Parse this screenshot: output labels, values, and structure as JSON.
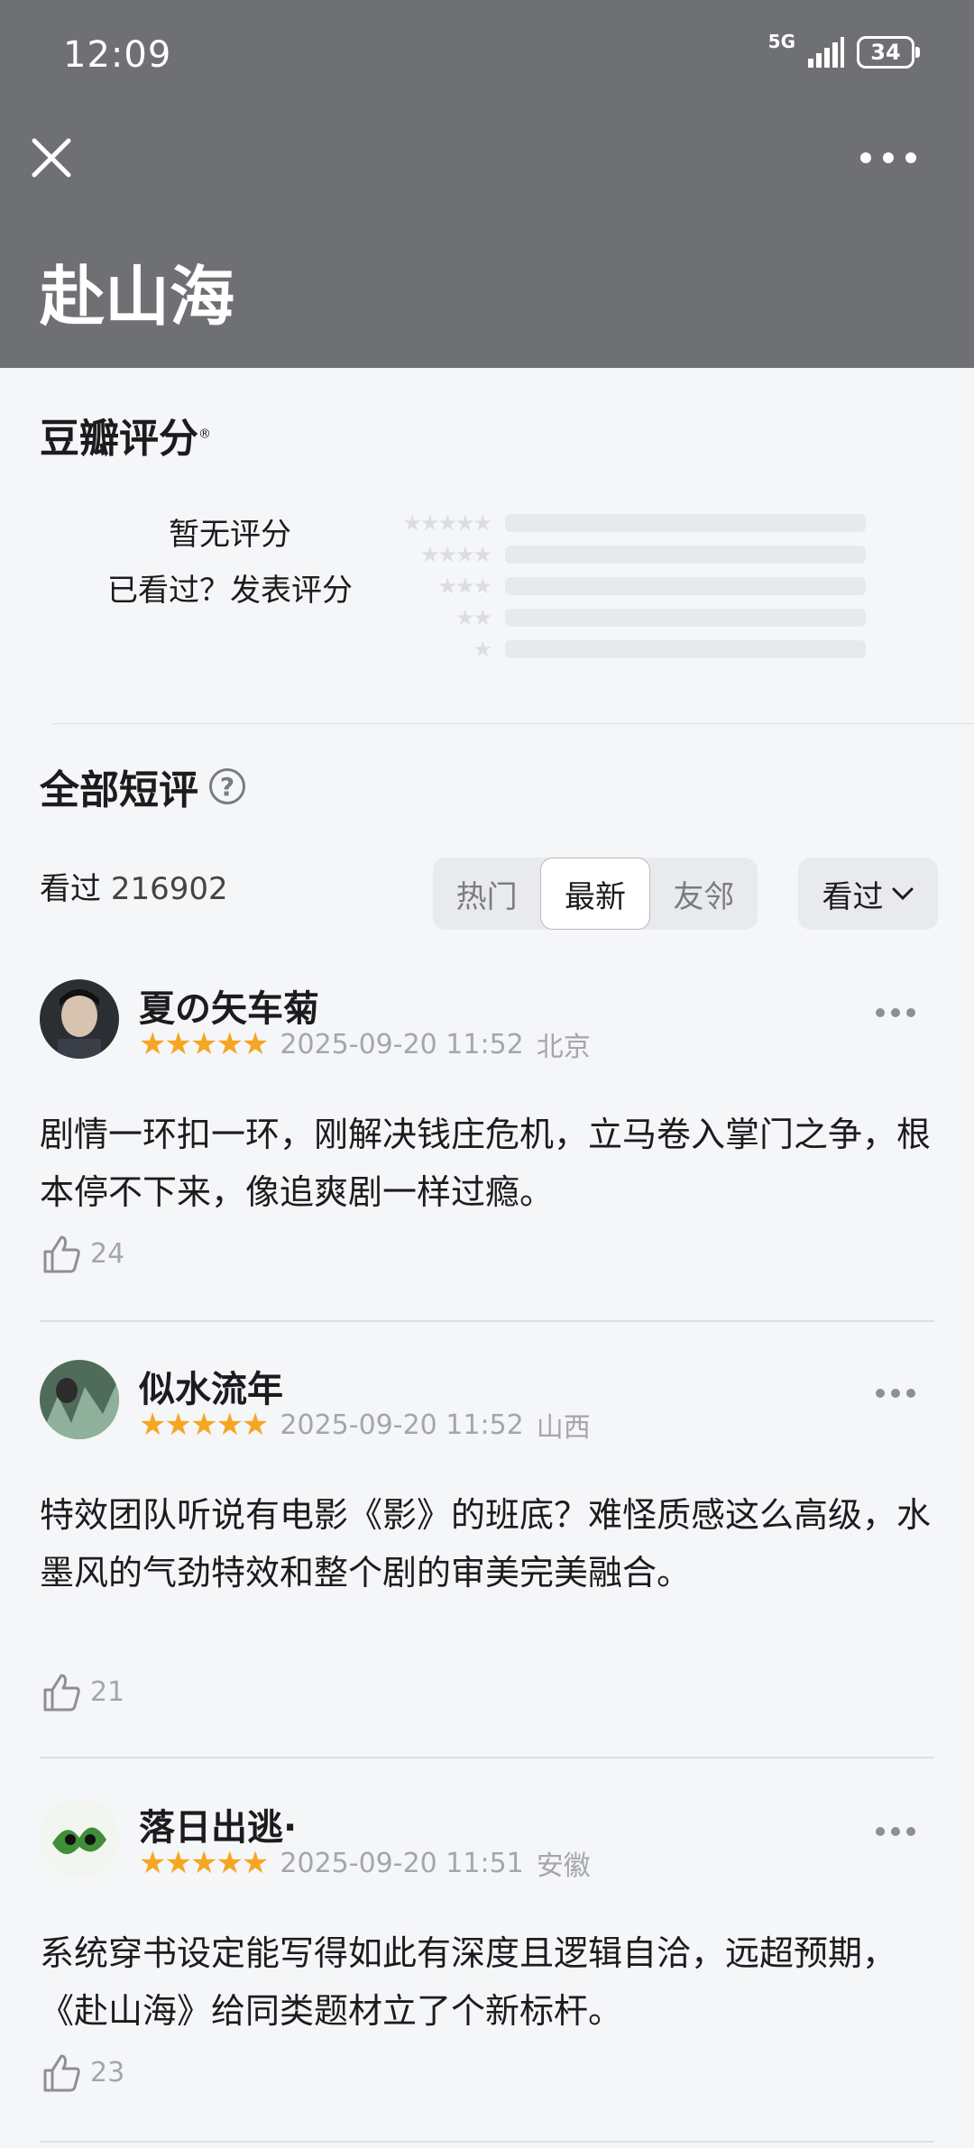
{
  "status_bar": {
    "time": "12:09",
    "network": "5G",
    "battery": "34"
  },
  "header": {
    "title": "赴山海"
  },
  "rating": {
    "title": "豆瓣评分",
    "mark": "®",
    "no_rating": "暂无评分",
    "call_to_action": "已看过？发表评分",
    "rows": [
      {
        "stars": "★★★★★"
      },
      {
        "stars": "★★★★"
      },
      {
        "stars": "★★★"
      },
      {
        "stars": "★★"
      },
      {
        "stars": "★"
      }
    ]
  },
  "comments_section": {
    "title": "全部短评",
    "help": "?",
    "seen_label": "看过",
    "seen_count": "216902",
    "tabs": [
      {
        "label": "热门",
        "active": false
      },
      {
        "label": "最新",
        "active": true
      },
      {
        "label": "友邻",
        "active": false
      }
    ],
    "filter_label": "看过"
  },
  "comments": [
    {
      "username": "夏の矢车菊",
      "rating": 5,
      "stars": "★★★★★",
      "timestamp": "2025-09-20 11:52",
      "location": "北京",
      "text": "剧情一环扣一环，刚解决钱庄危机，立马卷入掌门之争，根本停不下来，像追爽剧一样过瘾。",
      "likes": "24"
    },
    {
      "username": "似水流年",
      "rating": 5,
      "stars": "★★★★★",
      "timestamp": "2025-09-20 11:52",
      "location": "山西",
      "text": "特效团队听说有电影《影》的班底？难怪质感这么高级，水墨风的气劲特效和整个剧的审美完美融合。",
      "likes": "21"
    },
    {
      "username": "落日出逃·",
      "rating": 5,
      "stars": "★★★★★",
      "timestamp": "2025-09-20 11:51",
      "location": "安徽",
      "text": "系统穿书设定能写得如此有深度且逻辑自洽，远超预期，《赴山海》给同类题材立了个新标杆。",
      "likes": "23"
    }
  ],
  "colors": {
    "header_bg": "#6f7073",
    "star": "#f5a623",
    "page_bg": "#f5f6f8"
  }
}
